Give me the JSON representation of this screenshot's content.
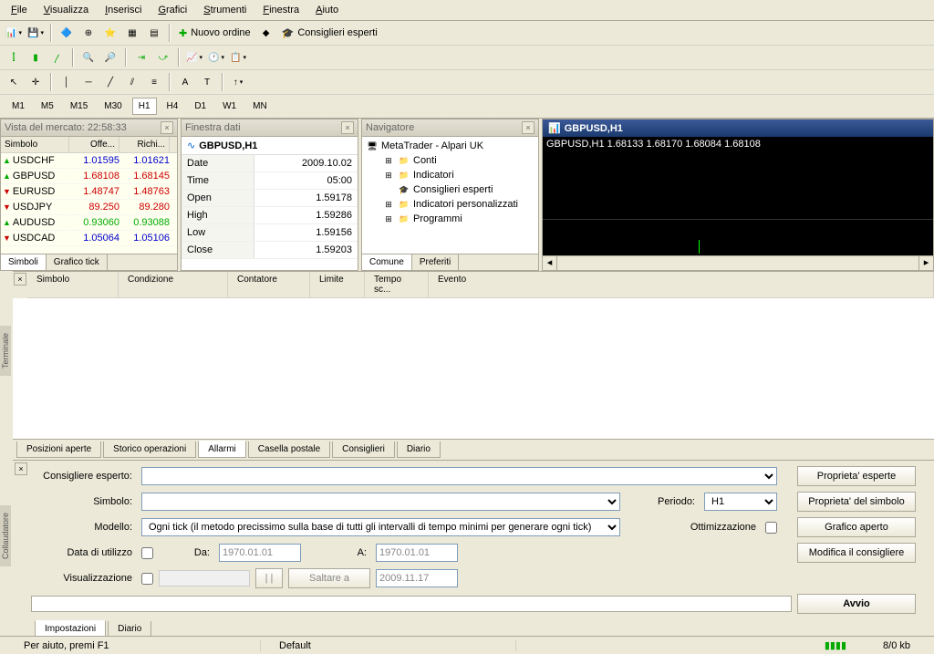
{
  "menu": [
    "File",
    "Visualizza",
    "Inserisci",
    "Grafici",
    "Strumenti",
    "Finestra",
    "Aiuto"
  ],
  "toolbar2": {
    "newOrder": "Nuovo ordine",
    "experts": "Consiglieri esperti"
  },
  "timeframes": [
    "M1",
    "M5",
    "M15",
    "M30",
    "H1",
    "H4",
    "D1",
    "W1",
    "MN"
  ],
  "tf_active": "H1",
  "market": {
    "title": "Vista del mercato: 22:58:33",
    "cols": [
      "Simbolo",
      "Offe...",
      "Richi..."
    ],
    "rows": [
      {
        "sym": "USDCHF",
        "bid": "1.01595",
        "ask": "1.01621",
        "dir": "up",
        "c": "n"
      },
      {
        "sym": "GBPUSD",
        "bid": "1.68108",
        "ask": "1.68145",
        "dir": "up",
        "c": "dn"
      },
      {
        "sym": "EURUSD",
        "bid": "1.48747",
        "ask": "1.48763",
        "dir": "dn",
        "c": "dn"
      },
      {
        "sym": "USDJPY",
        "bid": "89.250",
        "ask": "89.280",
        "dir": "dn",
        "c": "dn"
      },
      {
        "sym": "AUDUSD",
        "bid": "0.93060",
        "ask": "0.93088",
        "dir": "up",
        "c": "up"
      },
      {
        "sym": "USDCAD",
        "bid": "1.05064",
        "ask": "1.05106",
        "dir": "dn",
        "c": "n"
      }
    ],
    "tabs": [
      "Simboli",
      "Grafico tick"
    ]
  },
  "datawin": {
    "title": "Finestra dati",
    "symbol": "GBPUSD,H1",
    "rows": [
      [
        "Date",
        "2009.10.02"
      ],
      [
        "Time",
        "05:00"
      ],
      [
        "Open",
        "1.59178"
      ],
      [
        "High",
        "1.59286"
      ],
      [
        "Low",
        "1.59156"
      ],
      [
        "Close",
        "1.59203"
      ]
    ]
  },
  "nav": {
    "title": "Navigatore",
    "root": "MetaTrader - Alpari UK",
    "items": [
      "Conti",
      "Indicatori",
      "Consiglieri esperti",
      "Indicatori personalizzati",
      "Programmi"
    ],
    "tabs": [
      "Comune",
      "Preferiti"
    ]
  },
  "chart": {
    "title": "GBPUSD,H1",
    "ohlc": "GBPUSD,H1 1.68133 1.68170 1.68084 1.68108"
  },
  "terminal": {
    "label": "Terminale",
    "cols": [
      "Simbolo",
      "Condizione",
      "Contatore",
      "Limite",
      "Tempo sc...",
      "Evento"
    ],
    "tabs": [
      "Posizioni aperte",
      "Storico operazioni",
      "Allarmi",
      "Casella postale",
      "Consiglieri",
      "Diario"
    ],
    "active": "Allarmi"
  },
  "tester": {
    "label": "Collaudatore",
    "labels": {
      "expert": "Consigliere esperto:",
      "symbol": "Simbolo:",
      "model": "Modello:",
      "period": "Periodo:",
      "optimize": "Ottimizzazione",
      "useDate": "Data di utilizzo",
      "from": "Da:",
      "to": "A:",
      "visual": "Visualizzazione",
      "skipTo": "Saltare a"
    },
    "values": {
      "model": "Ogni tick (il metodo precissimo sulla base di tutti gli intervalli di tempo minimi per generare ogni tick)",
      "period": "H1",
      "date1": "1970.01.01",
      "date2": "1970.01.01",
      "date3": "2009.11.17"
    },
    "buttons": {
      "expertProps": "Proprieta' esperte",
      "symbolProps": "Proprieta' del simbolo",
      "openChart": "Grafico aperto",
      "modifyExpert": "Modifica il consigliere",
      "start": "Avvio",
      "pause": "| |"
    },
    "tabs": [
      "Impostazioni",
      "Diario"
    ]
  },
  "status": {
    "help": "Per aiuto, premi F1",
    "profile": "Default",
    "traffic": "8/0 kb"
  }
}
